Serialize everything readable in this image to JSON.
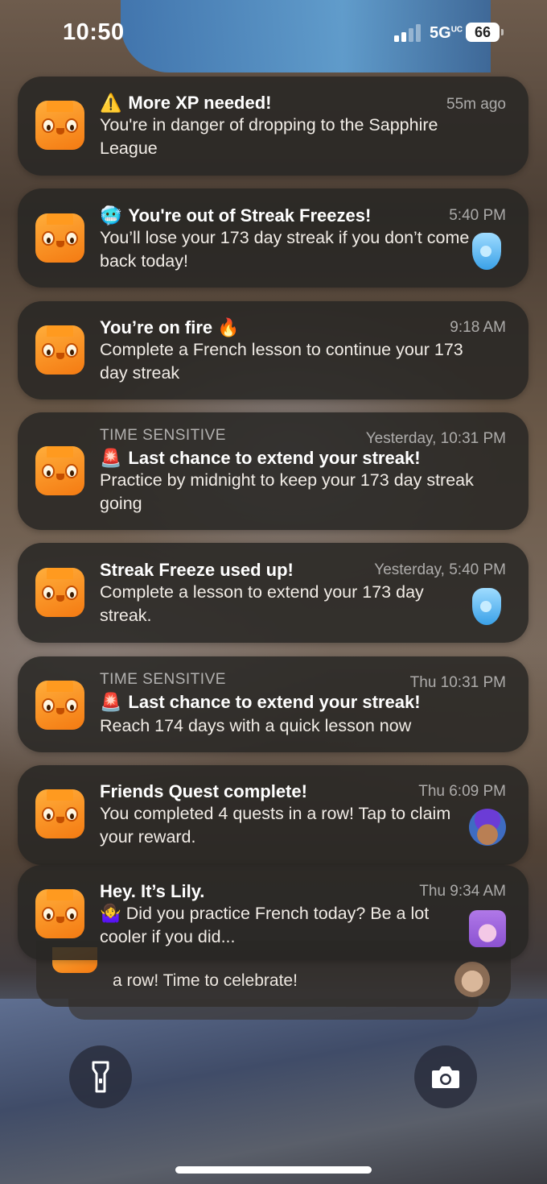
{
  "status_bar": {
    "time": "10:50",
    "network": "5G",
    "network_superscript": "UC",
    "battery": "66"
  },
  "notifications": [
    {
      "section": "",
      "emoji": "⚠️",
      "title": "More XP needed!",
      "body": "You're in danger of dropping to the Sapphire League",
      "time": "55m ago",
      "thumbnail": ""
    },
    {
      "section": "",
      "emoji": "🥶",
      "title": "You're out of Streak Freezes!",
      "body": "You’ll lose your 173 day streak if you don’t come back today!",
      "time": "5:40 PM",
      "thumbnail": "streak-freeze-icon"
    },
    {
      "section": "",
      "emoji": "",
      "title": "You’re on fire 🔥",
      "body": "Complete a French lesson to continue your 173 day streak",
      "time": "9:18 AM",
      "thumbnail": ""
    },
    {
      "section": "TIME SENSITIVE",
      "emoji": "🚨",
      "title": "Last chance to extend your streak!",
      "body": "Practice by midnight to keep your 173 day streak going",
      "time": "Yesterday, 10:31 PM",
      "thumbnail": ""
    },
    {
      "section": "",
      "emoji": "",
      "title": "Streak Freeze used up!",
      "body": "Complete a lesson to extend your 173 day streak.",
      "time": "Yesterday, 5:40 PM",
      "thumbnail": "streak-freeze-icon"
    },
    {
      "section": "TIME SENSITIVE",
      "emoji": "🚨",
      "title": "Last chance to extend your streak!",
      "body": "Reach 174 days with a quick lesson now",
      "time": "Thu 10:31 PM",
      "thumbnail": ""
    },
    {
      "section": "",
      "emoji": "",
      "title": "Friends Quest complete!",
      "body": "You completed 4 quests in a row! Tap to claim your reward.",
      "time": "Thu 6:09 PM",
      "thumbnail": "friend-avatar"
    },
    {
      "section": "",
      "emoji": "",
      "title": "Hey. It’s Lily.",
      "body": "🤷‍♀️ Did you practice French today? Be a lot cooler if you did...",
      "time": "Thu 9:34 AM",
      "thumbnail": "lily-avatar"
    }
  ],
  "stack_peek": {
    "body": "a row! Time to celebrate!"
  },
  "controls": {
    "flashlight": "flashlight-icon",
    "camera": "camera-icon"
  },
  "colors": {
    "card_bg": "#2a2725",
    "app_icon": "#f47a12",
    "text_secondary": "#a9a39c"
  }
}
